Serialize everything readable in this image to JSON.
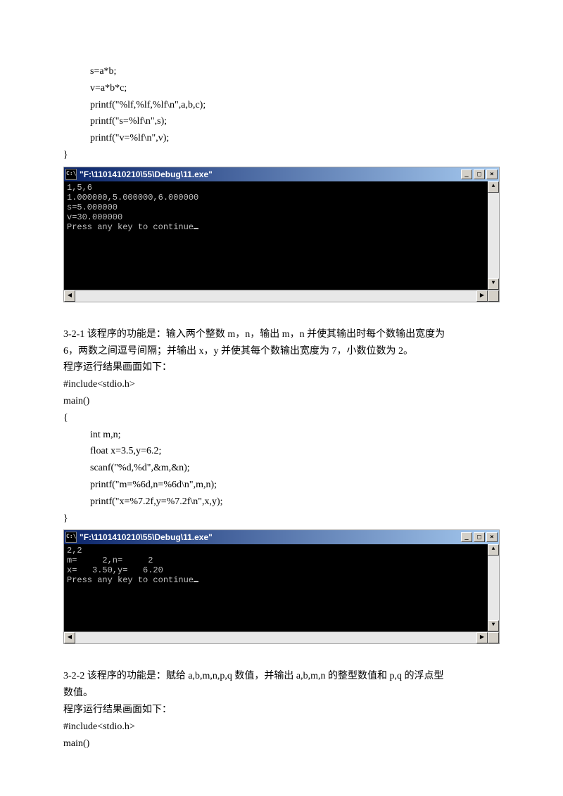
{
  "topcode": {
    "l1": "s=a*b;",
    "l2": "v=a*b*c;",
    "l3": "printf(\"%lf,%lf,%lf\\n\",a,b,c);",
    "l4": "printf(\"s=%lf\\n\",s);",
    "l5": "printf(\"v=%lf\\n\",v);",
    "l6": "}"
  },
  "console1": {
    "title": "\"F:\\1101410210\\55\\Debug\\11.exe\"",
    "sysicon": "C:\\",
    "lines": "1,5,6\n1.000000,5.000000,6.000000\ns=5.000000\nv=30.000000\nPress any key to continue",
    "min": "_",
    "max": "□",
    "close": "×",
    "up": "▲",
    "down": "▼",
    "left": "◀",
    "right": "▶"
  },
  "section321": {
    "heading": "3-2-1   该程序的功能是：输入两个整数 m，n，输出 m，n 并使其输出时每个数输出宽度为",
    "line2": "6，两数之间逗号间隔；并输出 x，y 并使其每个数输出宽度为 7，小数位数为 2。",
    "line3": "程序运行结果画面如下：",
    "c1": "#include<stdio.h>",
    "c2": "main()",
    "c3": "{",
    "c4": "int m,n;",
    "c5": "float x=3.5,y=6.2;",
    "c6": "scanf(\"%d,%d\",&m,&n);",
    "c7": "printf(\"m=%6d,n=%6d\\n\",m,n);",
    "c8": "printf(\"x=%7.2f,y=%7.2f\\n\",x,y);",
    "c9": "}"
  },
  "console2": {
    "title": "\"F:\\1101410210\\55\\Debug\\11.exe\"",
    "sysicon": "C:\\",
    "lines": "2,2\nm=     2,n=     2\nx=   3.50,y=   6.20\nPress any key to continue",
    "min": "_",
    "max": "□",
    "close": "×",
    "up": "▲",
    "down": "▼",
    "left": "◀",
    "right": "▶"
  },
  "section322": {
    "heading": "3-2-2   该程序的功能是：赋给 a,b,m,n,p,q 数值，并输出 a,b,m,n 的整型数值和 p,q 的浮点型",
    "line2": "数值。",
    "line3": "程序运行结果画面如下：",
    "c1": "#include<stdio.h>",
    "c2": "main()"
  }
}
